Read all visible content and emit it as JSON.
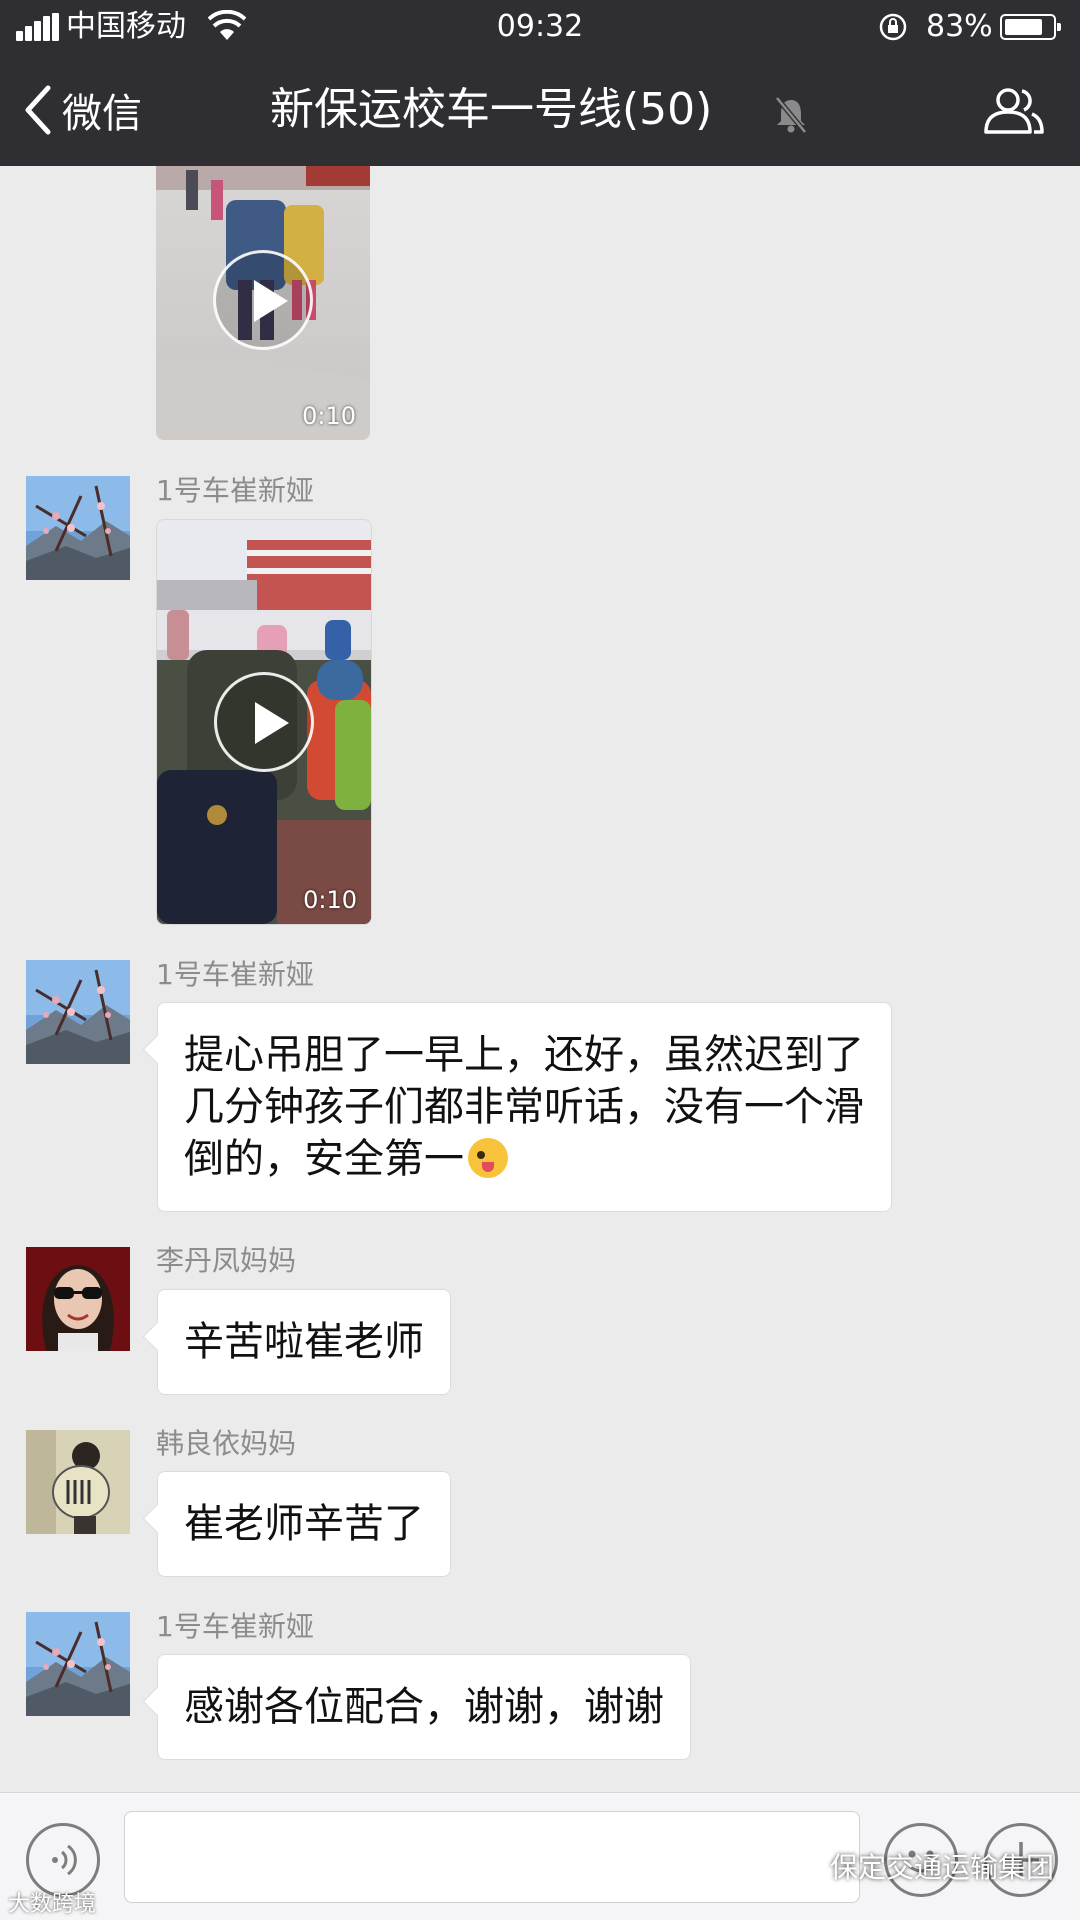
{
  "status_bar": {
    "carrier": "中国移动",
    "time": "09:32",
    "battery": "83%",
    "battery_level": 0.83
  },
  "nav": {
    "back_label": "微信",
    "title": "新保运校车一号线(50)"
  },
  "messages": [
    {
      "type": "video",
      "duration": "0:10"
    },
    {
      "type": "video",
      "sender": "1号车崔新娅",
      "duration": "0:10"
    },
    {
      "type": "text",
      "sender": "1号车崔新娅",
      "text": "提心吊胆了一早上，还好，虽然迟到了几分钟孩子们都非常听话，没有一个滑倒的，安全第一"
    },
    {
      "type": "text",
      "sender": "李丹凤妈妈",
      "text": "辛苦啦崔老师"
    },
    {
      "type": "text",
      "sender": "韩良依妈妈",
      "text": "崔老师辛苦了"
    },
    {
      "type": "text",
      "sender": "1号车崔新娅",
      "text": "感谢各位配合，谢谢，谢谢"
    }
  ],
  "watermark": {
    "text": "保定交通运输集团",
    "corner": "大数跨境"
  },
  "icons": {
    "back": "chevron-left-icon",
    "mute": "mute-bell-icon",
    "group": "group-members-icon",
    "voice": "voice-icon",
    "emoji": "emoji-icon",
    "plus": "plus-icon"
  }
}
